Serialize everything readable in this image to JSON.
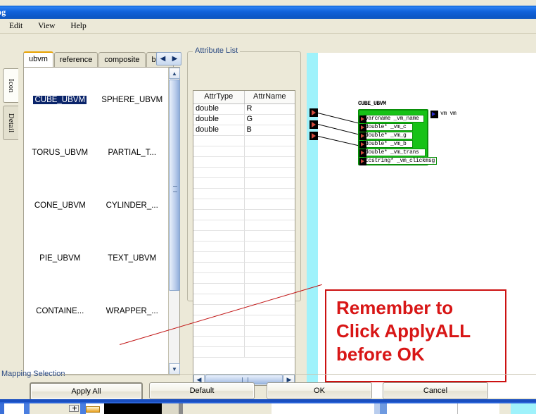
{
  "window": {
    "title": "og",
    "menu": [
      "Edit",
      "View",
      "Help"
    ]
  },
  "side_tabs": [
    {
      "label": "Icon",
      "selected": true
    },
    {
      "label": "Detail",
      "selected": false
    }
  ],
  "palette": {
    "tabs": [
      {
        "label": "ubvm",
        "selected": true
      },
      {
        "label": "reference",
        "selected": false
      },
      {
        "label": "composite",
        "selected": false
      },
      {
        "label": "basic",
        "selected": false
      }
    ],
    "scroll_left_icon": "chevron-left-icon",
    "scroll_right_icon": "chevron-right-icon",
    "items": [
      {
        "label": "CUBE_UBVM",
        "selected": true
      },
      {
        "label": "SPHERE_UBVM",
        "selected": false
      },
      {
        "label": "TORUS_UBVM",
        "selected": false
      },
      {
        "label": "PARTIAL_T...",
        "selected": false
      },
      {
        "label": "CONE_UBVM",
        "selected": false
      },
      {
        "label": "CYLINDER_...",
        "selected": false
      },
      {
        "label": "PIE_UBVM",
        "selected": false
      },
      {
        "label": "TEXT_UBVM",
        "selected": false
      },
      {
        "label": "CONTAINE...",
        "selected": false
      },
      {
        "label": "WRAPPER_...",
        "selected": false
      }
    ]
  },
  "attribute_list": {
    "title": "Attribute List",
    "columns": [
      "AttrType",
      "AttrName"
    ],
    "rows": [
      {
        "type": "double",
        "name": "R"
      },
      {
        "type": "double",
        "name": "G"
      },
      {
        "type": "double",
        "name": "B"
      }
    ],
    "scroll_left_icon": "arrow-left-icon",
    "scroll_right_icon": "arrow-right-icon"
  },
  "canvas": {
    "block_label": "CUBE_UBVM",
    "block_rows": [
      "varcname  _vm_name",
      "double*  _vm_c",
      "double*  _vm_g",
      "double*  _vm_b",
      "double*  _vm_trans",
      "tcstring*  _vm_clickmsg"
    ],
    "output_label": "vm  vm",
    "input_port_count": 3,
    "note": {
      "line1": "Remember to",
      "line2": "Click ApplyALL",
      "line3": "before OK",
      "color": "#d81616"
    }
  },
  "footer": {
    "section_label": "Mapping Selection",
    "buttons": [
      {
        "label": "Apply All",
        "primary": true
      },
      {
        "label": "Default",
        "primary": false
      },
      {
        "label": "OK",
        "primary": false
      },
      {
        "label": "Cancel",
        "primary": false
      }
    ]
  }
}
